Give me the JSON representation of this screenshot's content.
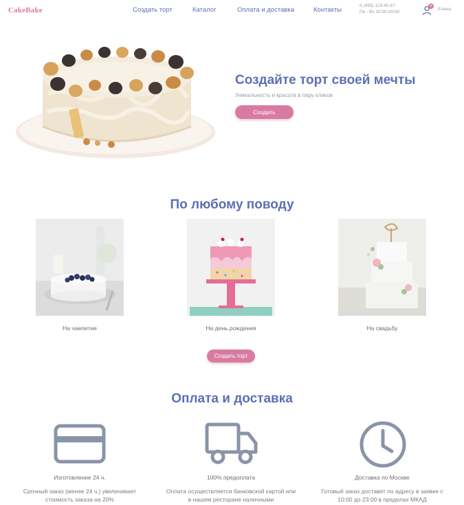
{
  "header": {
    "logo": "CakeBake",
    "nav": [
      "Создать торт",
      "Каталог",
      "Оплата и доставка",
      "Контакты"
    ],
    "phone": "8 (495) 123-45-67",
    "hours": "Пн - Вс 10:00-20:00",
    "user_badge": "0",
    "user_name": "Елена"
  },
  "hero": {
    "title": "Создайте торт своей мечты",
    "subtitle": "Уникальность и красота в пару кликов",
    "button": "Создать"
  },
  "occasions": {
    "title": "По любому поводу",
    "items": [
      {
        "label": "На чаепитие"
      },
      {
        "label": "На день рождения"
      },
      {
        "label": "На свадьбу"
      }
    ],
    "button": "Создать торт"
  },
  "payment": {
    "title": "Оплата и доставка",
    "features": [
      {
        "icon": "credit-card-icon",
        "name": "Изготовление 24 ч.",
        "desc_1": "Срочный заказ (менее 24 ч.) увеличивает",
        "desc_2": "стоимость заказа на 20%"
      },
      {
        "icon": "truck-icon",
        "name": "100% предоплата",
        "desc_1": "Оплата осуществляется банковской картой или",
        "desc_2": "в нашем ресторане наличными"
      },
      {
        "icon": "clock-icon",
        "name": "Доставка по Москве",
        "desc_1": "Готовый заказ доставят по адресу в заявке с",
        "desc_2": "10:00 до 23:00 в пределах МКАД"
      }
    ],
    "icon_color": "#8a94a8"
  },
  "colors": {
    "brand_pink": "#d97ba0",
    "heading_blue": "#5c6fb5"
  }
}
